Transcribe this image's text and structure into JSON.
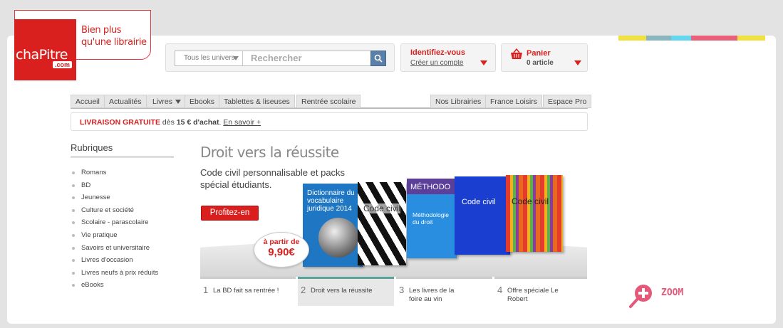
{
  "header": {
    "logo_word": "chaPitre",
    "logo_suffix": ".com",
    "tagline_line1": "Bien plus",
    "tagline_line2": "qu'une librairie"
  },
  "colors": {
    "brand_red": "#d9201e",
    "accent_teal": "#5aa39b",
    "zoom_pink": "#e5587a"
  },
  "color_strip": [
    "#f0e040",
    "#8ab6c0",
    "#64d6ee",
    "#e8607a",
    "#e8607a",
    "#f0e040"
  ],
  "search": {
    "scope_label": "Tous les univers",
    "placeholder": "Rechercher",
    "button_icon": "magnifier-icon"
  },
  "account": {
    "title": "Identifiez-vous",
    "link": "Créer un compte"
  },
  "cart": {
    "title": "Panier",
    "count": "0 article",
    "icon": "basket-icon"
  },
  "nav": {
    "left": [
      "Accueil",
      "Actualités",
      "Livres",
      "Ebooks",
      "Tablettes & liseuses",
      "Rentrée scolaire"
    ],
    "right": [
      "Nos Librairies",
      "France Loisirs",
      "Espace Pro"
    ]
  },
  "promo": {
    "highlight": "LIVRAISON GRATUITE",
    "text1": " dès ",
    "amount": "15 € d'achat",
    "text2": ". ",
    "link": "En savoir +"
  },
  "rubriques": {
    "title": "Rubriques",
    "items": [
      "Romans",
      "BD",
      "Jeunesse",
      "Culture et société",
      "Scolaire - parascolaire",
      "Vie pratique",
      "Savoirs et universitaire",
      "Livres d'occasion",
      "Livres neufs à prix réduits",
      "eBooks"
    ]
  },
  "hero": {
    "title": "Droit vers la réussite",
    "subtitle": "Code civil personnalisable et packs spécial étudiants.",
    "cta": "Profitez-en",
    "price_prefix": "à partir de",
    "price": "9,90€",
    "books": [
      {
        "title": "Dictionnaire du vocabulaire juridique 2014"
      },
      {
        "title": "Code civil"
      },
      {
        "title": "MÉTHODO"
      },
      {
        "title": "Méthodologie du droit"
      },
      {
        "title": "Code civil"
      },
      {
        "title": "Code civil"
      }
    ]
  },
  "slides": [
    {
      "num": "1",
      "label": "La BD fait sa rentrée !"
    },
    {
      "num": "2",
      "label": "Droit vers la réussite"
    },
    {
      "num": "3",
      "label": "Les livres de la foire au vin"
    },
    {
      "num": "4",
      "label": "Offre spéciale Le Robert"
    }
  ],
  "zoom": {
    "label": "ZOOM",
    "icon": "zoom-plus-icon"
  }
}
